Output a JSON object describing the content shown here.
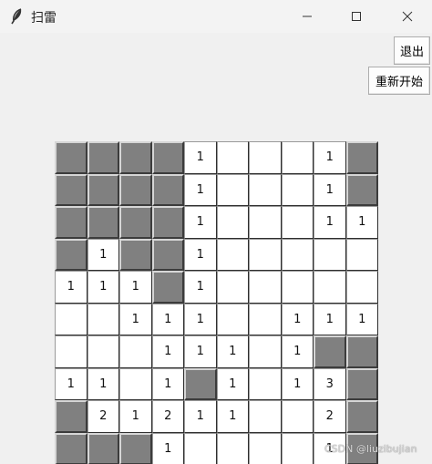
{
  "window": {
    "title": "扫雷"
  },
  "controls": {
    "exit_label": "退出",
    "restart_label": "重新开始"
  },
  "board": {
    "rows": [
      [
        "C",
        "C",
        "C",
        "C",
        "1",
        "",
        "",
        "",
        "1",
        "C"
      ],
      [
        "C",
        "C",
        "C",
        "C",
        "1",
        "",
        "",
        "",
        "1",
        "C"
      ],
      [
        "C",
        "C",
        "C",
        "C",
        "1",
        "",
        "",
        "",
        "1",
        "1"
      ],
      [
        "C",
        "1",
        "C",
        "C",
        "1",
        "",
        "",
        "",
        "",
        ""
      ],
      [
        "1",
        "1",
        "1",
        "C",
        "1",
        "",
        "",
        "",
        "",
        ""
      ],
      [
        "",
        "",
        "1",
        "1",
        "1",
        "",
        "",
        "1",
        "1",
        "1"
      ],
      [
        "",
        "",
        "",
        "1",
        "1",
        "1",
        "",
        "1",
        "C",
        "C"
      ],
      [
        "1",
        "1",
        "",
        "1",
        "C",
        "1",
        "",
        "1",
        "3",
        "C"
      ],
      [
        "C",
        "2",
        "1",
        "2",
        "1",
        "1",
        "",
        "",
        "2",
        "C"
      ],
      [
        "C",
        "C",
        "C",
        "1",
        "",
        "",
        "",
        "",
        "1",
        "C"
      ]
    ]
  },
  "watermark": "CSDN @liuzibujian"
}
